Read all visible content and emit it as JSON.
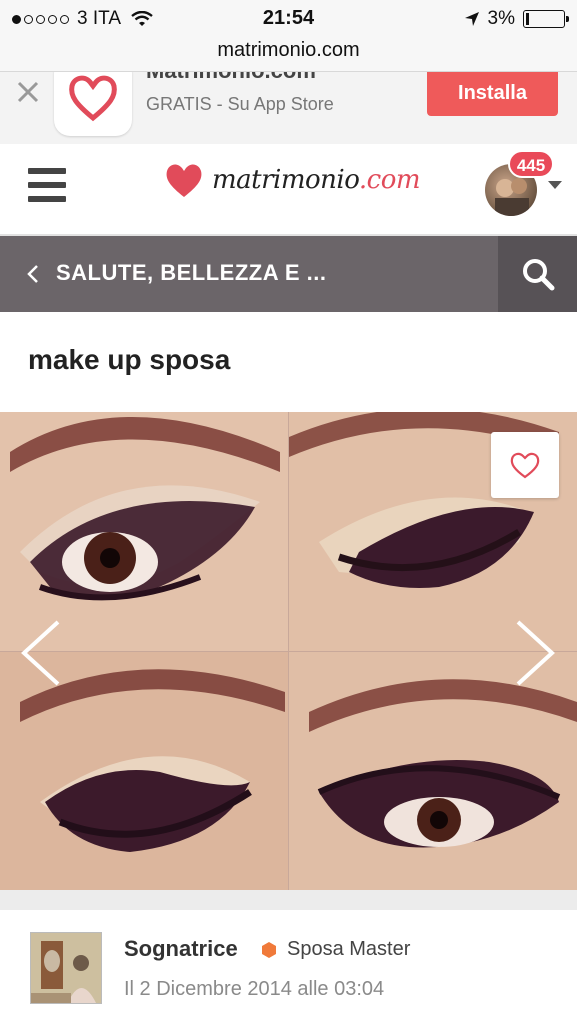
{
  "status_bar": {
    "carrier": "3 ITA",
    "time": "21:54",
    "battery": "3%"
  },
  "browser": {
    "url": "matrimonio.com"
  },
  "app_banner": {
    "app_name": "Matrimonio.com",
    "subtitle": "GRATIS - Su App Store",
    "install_label": "Installa"
  },
  "header": {
    "logo_word": "matrimonio",
    "logo_domain": ".com",
    "notification_count": "445"
  },
  "category_bar": {
    "title": "SALUTE, BELLEZZA E ..."
  },
  "post": {
    "title": "make up sposa",
    "author": {
      "name": "Sognatrice",
      "rank": "Sposa Master",
      "date": "Il 2 Dicembre 2014 alle 03:04"
    }
  },
  "colors": {
    "accent": "#ef5a5a",
    "category_bar": "#6b6569",
    "badge": "#e94a59"
  },
  "icons": [
    "close-icon",
    "heart-logo-icon",
    "menu-icon",
    "chevron-left-icon",
    "search-icon",
    "heart-icon",
    "chevron-right-icon",
    "hexagon-icon"
  ]
}
